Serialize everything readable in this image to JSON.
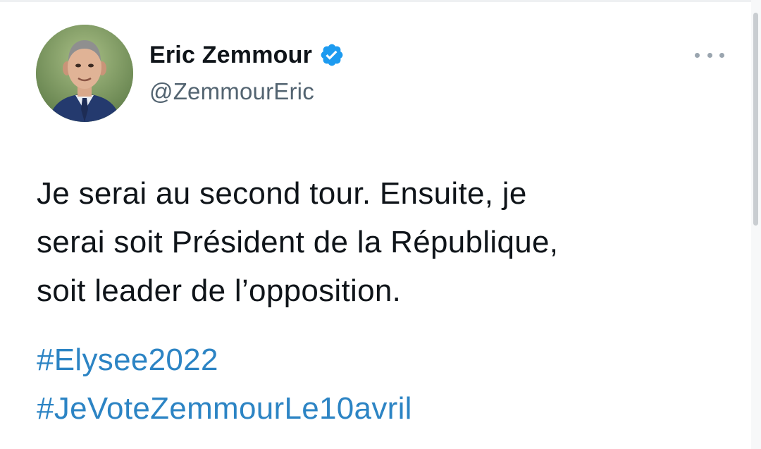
{
  "author": {
    "display_name": "Eric Zemmour",
    "handle": "@ZemmourEric",
    "verified": true
  },
  "tweet": {
    "text_lines": [
      "Je serai au second tour. Ensuite, je",
      "serai soit Président de la République,",
      "soit leader de l’opposition."
    ],
    "hashtags": [
      "#Elysee2022",
      "#JeVoteZemmourLe10avril"
    ]
  },
  "icons": {
    "verified": "verified-badge-icon",
    "more": "more-options-icon"
  },
  "colors": {
    "text": "#0f1419",
    "secondary": "#536471",
    "link": "#2c84c4",
    "verified": "#1d9bf0"
  }
}
